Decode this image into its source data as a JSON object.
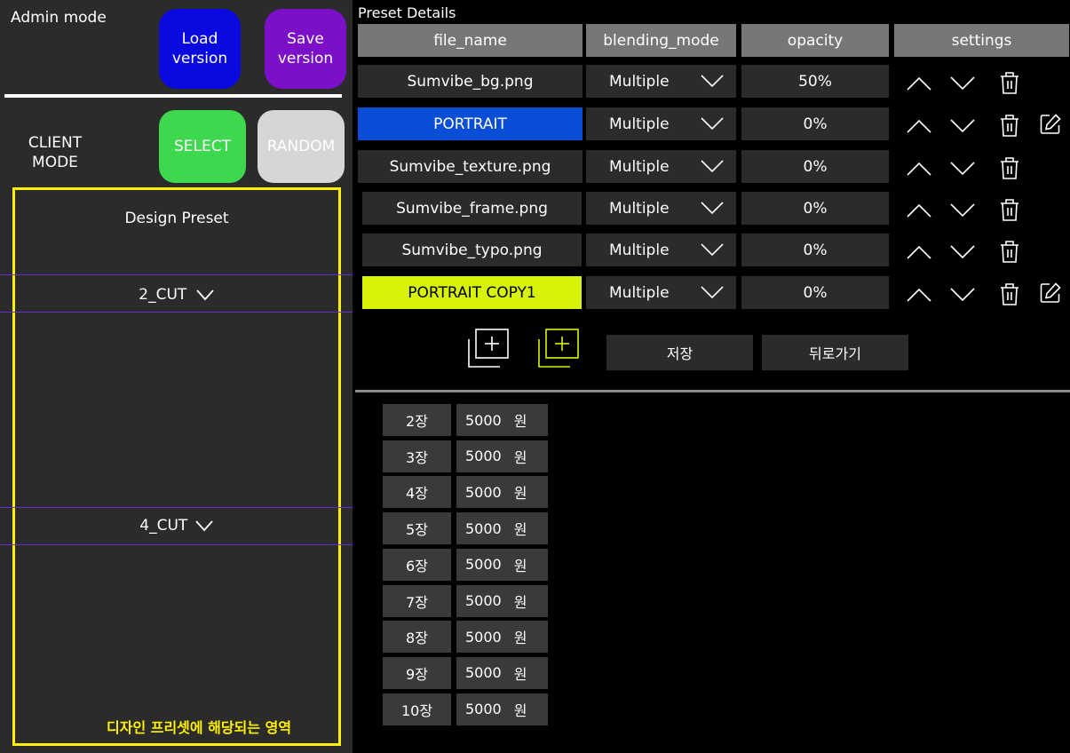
{
  "admin": {
    "mode_label": "Admin mode",
    "load_label": "Load\nversion",
    "save_label": "Save\nversion"
  },
  "client": {
    "mode_label": "CLIENT\nMODE",
    "select_label": "SELECT",
    "random_label": "RANDOM"
  },
  "design": {
    "title": "Design Preset",
    "cut2": "2_CUT",
    "cut4": "4_CUT",
    "note": "디자인 프리셋에 해당되는 영역"
  },
  "preset": {
    "title": "Preset Details",
    "headers": [
      "file_name",
      "blending_mode",
      "opacity",
      "settings"
    ],
    "rows": [
      {
        "file": "Sumvibe_bg.png",
        "blend": "Multiple",
        "opacity": "50%"
      },
      {
        "file": "PORTRAIT",
        "blend": "Multiple",
        "opacity": "0%"
      },
      {
        "file": "Sumvibe_texture.png",
        "blend": "Multiple",
        "opacity": "0%"
      },
      {
        "file": "Sumvibe_frame.png",
        "blend": "Multiple",
        "opacity": "0%"
      },
      {
        "file": "Sumvibe_typo.png",
        "blend": "Multiple",
        "opacity": "0%"
      },
      {
        "file": "PORTRAIT COPY1",
        "blend": "Multiple",
        "opacity": "0%"
      }
    ],
    "save_label": "저장",
    "back_label": "뒤로가기"
  },
  "prices": [
    {
      "count": "2장",
      "amount": "5000",
      "unit": "원"
    },
    {
      "count": "3장",
      "amount": "5000",
      "unit": "원"
    },
    {
      "count": "4장",
      "amount": "5000",
      "unit": "원"
    },
    {
      "count": "5장",
      "amount": "5000",
      "unit": "원"
    },
    {
      "count": "6장",
      "amount": "5000",
      "unit": "원"
    },
    {
      "count": "7장",
      "amount": "5000",
      "unit": "원"
    },
    {
      "count": "8장",
      "amount": "5000",
      "unit": "원"
    },
    {
      "count": "9장",
      "amount": "5000",
      "unit": "원"
    },
    {
      "count": "10장",
      "amount": "5000",
      "unit": "원"
    }
  ],
  "colors": {
    "load": "#0a0ae0",
    "save": "#7b10c8",
    "select": "#3ed84e",
    "random": "#d6d6d6",
    "portrait": "#0a4ed8",
    "portrait_copy": "#d8f20a",
    "highlight": "#fff200"
  },
  "icons": {
    "add_layer": "add-layer-icon",
    "add_portrait": "add-portrait-icon",
    "up": "chevron-up-icon",
    "down": "chevron-down-icon",
    "trash": "trash-icon",
    "edit": "edit-icon"
  }
}
